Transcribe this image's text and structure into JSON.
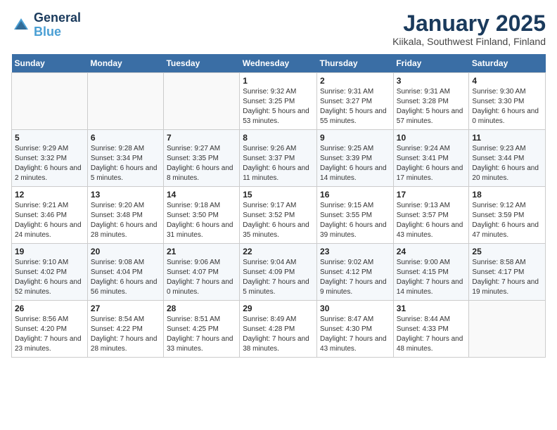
{
  "header": {
    "logo_line1": "General",
    "logo_line2": "Blue",
    "month": "January 2025",
    "location": "Kiikala, Southwest Finland, Finland"
  },
  "weekdays": [
    "Sunday",
    "Monday",
    "Tuesday",
    "Wednesday",
    "Thursday",
    "Friday",
    "Saturday"
  ],
  "weeks": [
    [
      {
        "day": "",
        "info": ""
      },
      {
        "day": "",
        "info": ""
      },
      {
        "day": "",
        "info": ""
      },
      {
        "day": "1",
        "info": "Sunrise: 9:32 AM\nSunset: 3:25 PM\nDaylight: 5 hours\nand 53 minutes."
      },
      {
        "day": "2",
        "info": "Sunrise: 9:31 AM\nSunset: 3:27 PM\nDaylight: 5 hours\nand 55 minutes."
      },
      {
        "day": "3",
        "info": "Sunrise: 9:31 AM\nSunset: 3:28 PM\nDaylight: 5 hours\nand 57 minutes."
      },
      {
        "day": "4",
        "info": "Sunrise: 9:30 AM\nSunset: 3:30 PM\nDaylight: 6 hours\nand 0 minutes."
      }
    ],
    [
      {
        "day": "5",
        "info": "Sunrise: 9:29 AM\nSunset: 3:32 PM\nDaylight: 6 hours\nand 2 minutes."
      },
      {
        "day": "6",
        "info": "Sunrise: 9:28 AM\nSunset: 3:34 PM\nDaylight: 6 hours\nand 5 minutes."
      },
      {
        "day": "7",
        "info": "Sunrise: 9:27 AM\nSunset: 3:35 PM\nDaylight: 6 hours\nand 8 minutes."
      },
      {
        "day": "8",
        "info": "Sunrise: 9:26 AM\nSunset: 3:37 PM\nDaylight: 6 hours\nand 11 minutes."
      },
      {
        "day": "9",
        "info": "Sunrise: 9:25 AM\nSunset: 3:39 PM\nDaylight: 6 hours\nand 14 minutes."
      },
      {
        "day": "10",
        "info": "Sunrise: 9:24 AM\nSunset: 3:41 PM\nDaylight: 6 hours\nand 17 minutes."
      },
      {
        "day": "11",
        "info": "Sunrise: 9:23 AM\nSunset: 3:44 PM\nDaylight: 6 hours\nand 20 minutes."
      }
    ],
    [
      {
        "day": "12",
        "info": "Sunrise: 9:21 AM\nSunset: 3:46 PM\nDaylight: 6 hours\nand 24 minutes."
      },
      {
        "day": "13",
        "info": "Sunrise: 9:20 AM\nSunset: 3:48 PM\nDaylight: 6 hours\nand 28 minutes."
      },
      {
        "day": "14",
        "info": "Sunrise: 9:18 AM\nSunset: 3:50 PM\nDaylight: 6 hours\nand 31 minutes."
      },
      {
        "day": "15",
        "info": "Sunrise: 9:17 AM\nSunset: 3:52 PM\nDaylight: 6 hours\nand 35 minutes."
      },
      {
        "day": "16",
        "info": "Sunrise: 9:15 AM\nSunset: 3:55 PM\nDaylight: 6 hours\nand 39 minutes."
      },
      {
        "day": "17",
        "info": "Sunrise: 9:13 AM\nSunset: 3:57 PM\nDaylight: 6 hours\nand 43 minutes."
      },
      {
        "day": "18",
        "info": "Sunrise: 9:12 AM\nSunset: 3:59 PM\nDaylight: 6 hours\nand 47 minutes."
      }
    ],
    [
      {
        "day": "19",
        "info": "Sunrise: 9:10 AM\nSunset: 4:02 PM\nDaylight: 6 hours\nand 52 minutes."
      },
      {
        "day": "20",
        "info": "Sunrise: 9:08 AM\nSunset: 4:04 PM\nDaylight: 6 hours\nand 56 minutes."
      },
      {
        "day": "21",
        "info": "Sunrise: 9:06 AM\nSunset: 4:07 PM\nDaylight: 7 hours\nand 0 minutes."
      },
      {
        "day": "22",
        "info": "Sunrise: 9:04 AM\nSunset: 4:09 PM\nDaylight: 7 hours\nand 5 minutes."
      },
      {
        "day": "23",
        "info": "Sunrise: 9:02 AM\nSunset: 4:12 PM\nDaylight: 7 hours\nand 9 minutes."
      },
      {
        "day": "24",
        "info": "Sunrise: 9:00 AM\nSunset: 4:15 PM\nDaylight: 7 hours\nand 14 minutes."
      },
      {
        "day": "25",
        "info": "Sunrise: 8:58 AM\nSunset: 4:17 PM\nDaylight: 7 hours\nand 19 minutes."
      }
    ],
    [
      {
        "day": "26",
        "info": "Sunrise: 8:56 AM\nSunset: 4:20 PM\nDaylight: 7 hours\nand 23 minutes."
      },
      {
        "day": "27",
        "info": "Sunrise: 8:54 AM\nSunset: 4:22 PM\nDaylight: 7 hours\nand 28 minutes."
      },
      {
        "day": "28",
        "info": "Sunrise: 8:51 AM\nSunset: 4:25 PM\nDaylight: 7 hours\nand 33 minutes."
      },
      {
        "day": "29",
        "info": "Sunrise: 8:49 AM\nSunset: 4:28 PM\nDaylight: 7 hours\nand 38 minutes."
      },
      {
        "day": "30",
        "info": "Sunrise: 8:47 AM\nSunset: 4:30 PM\nDaylight: 7 hours\nand 43 minutes."
      },
      {
        "day": "31",
        "info": "Sunrise: 8:44 AM\nSunset: 4:33 PM\nDaylight: 7 hours\nand 48 minutes."
      },
      {
        "day": "",
        "info": ""
      }
    ]
  ]
}
